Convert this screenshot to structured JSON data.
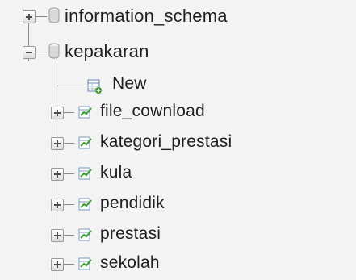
{
  "tree": {
    "databases": [
      {
        "name": "information_schema",
        "expanded": false
      },
      {
        "name": "kepakaran",
        "expanded": true
      }
    ],
    "new_item_label": "New",
    "tables": [
      "file_cownload",
      "kategori_prestasi",
      "kula",
      "pendidik",
      "prestasi",
      "sekolah"
    ]
  },
  "colors": {
    "background": "#f3f3f3",
    "tree_line": "#8a8a8a",
    "table_icon_green": "#3a9a2a",
    "db_icon": "#d9d9d9"
  },
  "icons": {
    "database": "database-icon",
    "new": "new-table-icon",
    "table": "table-icon",
    "expand": "plus-icon",
    "collapse": "minus-icon"
  }
}
